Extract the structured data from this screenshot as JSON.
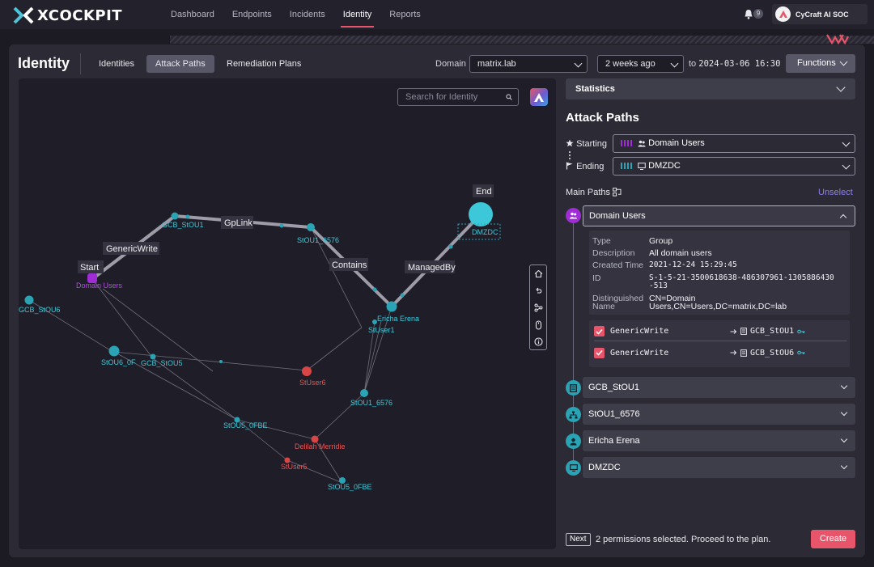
{
  "app": {
    "brand": "XCOCKPIT",
    "org_name": "CyCraft AI SOC",
    "notification_count": "9"
  },
  "nav": {
    "items": [
      {
        "label": "Dashboard"
      },
      {
        "label": "Endpoints"
      },
      {
        "label": "Incidents"
      },
      {
        "label": "Identity"
      },
      {
        "label": "Reports"
      }
    ],
    "active": "Identity"
  },
  "page": {
    "title": "Identity",
    "tabs": [
      {
        "label": "Identities"
      },
      {
        "label": "Attack Paths"
      },
      {
        "label": "Remediation Plans"
      }
    ],
    "active_tab": "Attack Paths",
    "domain_label": "Domain",
    "domain_value": "matrix.lab",
    "range_value": "2 weeks ago",
    "to_label": "to",
    "to_date": "2024-03-06 16:30",
    "functions_label": "Functions"
  },
  "graph": {
    "search_placeholder": "Search for Identity",
    "colors": {
      "group": "#a02cd6",
      "node": "#2aa3b4",
      "user": "#d84545",
      "edge": "#8d8c98"
    },
    "edge_labels": {
      "start": "Start",
      "generic_write": "GenericWrite",
      "gplink": "GpLink",
      "contains": "Contains",
      "managed_by": "ManagedBy",
      "end": "End"
    },
    "node_labels": {
      "domain_users": "Domain Users",
      "gcb_stou1": "GCB_StOU1",
      "stou1_6576_top": "StOU1_6576",
      "dmzdc": "DMZDC",
      "gcb_stou6": "GCB_StOU6",
      "ericha": "Ericha Erena",
      "stuser1": "StUser1",
      "stou6_0f": "StOU6_0F",
      "gcb_stou5": "GCB_StOU5",
      "stuser6": "StUser6",
      "stou1_6576_low": "StOU1_6576",
      "stou5_0fbe_a": "StOU5_0FBE",
      "delilah": "Delilah Merridie",
      "stuser5": "StUser5",
      "stou5_0fbe_b": "StOU5_0FBE"
    }
  },
  "side": {
    "statistics_label": "Statistics",
    "attack_paths_title": "Attack Paths",
    "starting_label": "Starting",
    "starting_value": "Domain Users",
    "ending_label": "Ending",
    "ending_value": "DMZDC",
    "main_paths_label": "Main Paths",
    "unselect_label": "Unselect",
    "steps": [
      {
        "label": "Domain Users"
      },
      {
        "label": "GCB_StOU1"
      },
      {
        "label": "StOU1_6576"
      },
      {
        "label": "Ericha Erena"
      },
      {
        "label": "DMZDC"
      }
    ],
    "detail": {
      "type_label": "Type",
      "type_value": "Group",
      "description_label": "Description",
      "description_value": "All domain users",
      "created_label": "Created Time",
      "created_value": "2021-12-24 15:29:45",
      "id_label": "ID",
      "id_line1": "S-1-5-21-3500618638-486307961-1305886430",
      "id_line2": "-513",
      "dn_label_line1": "Distinguished",
      "dn_label_line2": "Name",
      "dn_line1": "CN=Domain",
      "dn_line2": "Users,CN=Users,DC=matrix,DC=lab"
    },
    "permissions": [
      {
        "name": "GenericWrite",
        "target": "GCB_StOU1"
      },
      {
        "name": "GenericWrite",
        "target": "GCB_StOU6"
      }
    ],
    "next_tag": "Next",
    "next_message": "2 permissions selected. Proceed to the plan.",
    "create_label": "Create"
  }
}
